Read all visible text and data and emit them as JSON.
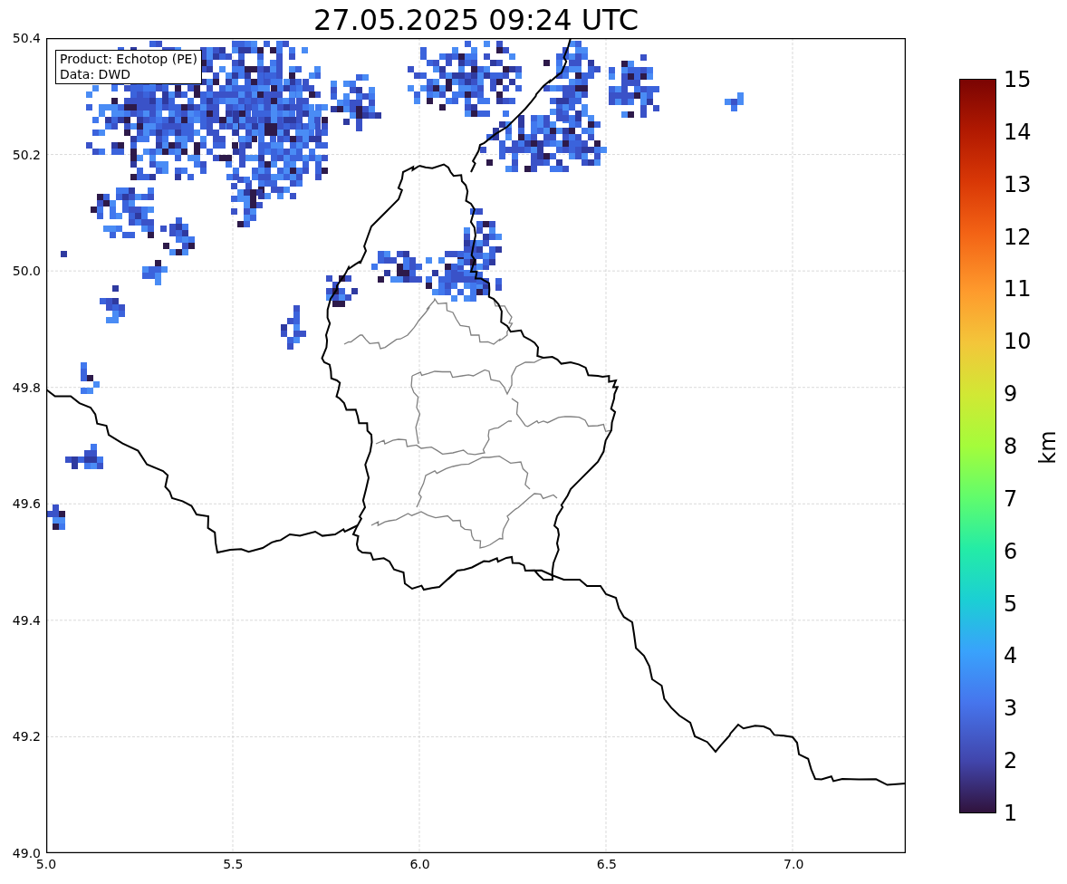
{
  "title": "27.05.2025 09:24 UTC",
  "map": {
    "annotation": [
      "Product: Echotop (PE)",
      "Data: DWD"
    ],
    "x_ticks": [
      "5.0",
      "5.5",
      "6.0",
      "6.5",
      "7.0"
    ],
    "y_ticks": [
      "50.4",
      "50.2",
      "50.0",
      "49.8",
      "49.6",
      "49.4",
      "49.2",
      "49.0"
    ]
  },
  "colorbar": {
    "label": "km",
    "ticks": [
      "15",
      "14",
      "13",
      "12",
      "11",
      "10",
      "9",
      "8",
      "7",
      "6",
      "5",
      "4",
      "3",
      "2",
      "1"
    ]
  }
}
